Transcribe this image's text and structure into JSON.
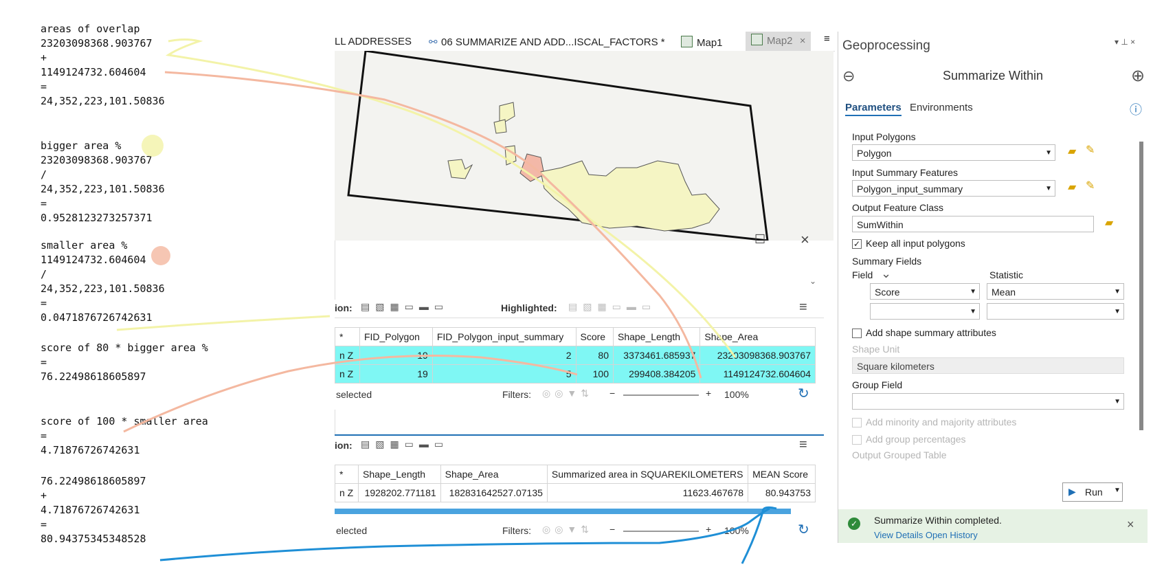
{
  "notes": [
    "areas of overlap",
    "23203098368.903767",
    "+",
    "1149124732.604604",
    "=",
    "24,352,223,101.50836",
    "bigger area %",
    "23203098368.903767",
    "/",
    "24,352,223,101.50836",
    "=",
    "0.9528123273257371",
    "smaller area %",
    "1149124732.604604",
    "/",
    "24,352,223,101.50836",
    "=",
    "0.0471876726742631",
    "score of 80 * bigger area %",
    "=",
    "76.22498618605897",
    "score of 100 * smaller area",
    "=",
    "4.71876726742631",
    "76.22498618605897",
    "+",
    "4.71876726742631",
    "=",
    "80.94375345348528"
  ],
  "tabs": {
    "t1": "LL ADDRESSES",
    "t2": "06 SUMMARIZE AND ADD...ISCAL_FACTORS *",
    "t3": "Map1",
    "t4": "Map2",
    "close": "×",
    "menu": "≡"
  },
  "pane": {
    "maximize": "☐",
    "close": "×",
    "chevron": "⌄"
  },
  "table1": {
    "selection_label": "ion:",
    "highlighted_label": "Highlighted:",
    "headers": [
      "*",
      "FID_Polygon",
      "FID_Polygon_input_summary",
      "Score",
      "Shape_Length",
      "Shape_Area"
    ],
    "rows": [
      [
        "n Z",
        "19",
        "2",
        "80",
        "3373461.685937",
        "23203098368.903767"
      ],
      [
        "n Z",
        "19",
        "5",
        "100",
        "299408.384205",
        "1149124732.604604"
      ]
    ],
    "status": "selected",
    "filters": "Filters:",
    "zoom": "100%"
  },
  "table2": {
    "selection_label": "ion:",
    "headers": [
      "*",
      "Shape_Length",
      "Shape_Area",
      "Summarized area in SQUAREKILOMETERS",
      "MEAN Score"
    ],
    "row": [
      "n Z",
      "1928202.771181",
      "182831642527.07135",
      "11623.467678",
      "80.943753"
    ],
    "status": "elected",
    "filters": "Filters:",
    "zoom": "100%"
  },
  "gp": {
    "title": "Geoprocessing",
    "tool": "Summarize Within",
    "tab_params": "Parameters",
    "tab_env": "Environments",
    "input_polygons_label": "Input Polygons",
    "input_polygons_value": "Polygon",
    "input_summary_label": "Input Summary Features",
    "input_summary_value": "Polygon_input_summary",
    "output_label": "Output Feature Class",
    "output_value": "SumWithin",
    "keep_all": "Keep all input polygons",
    "summary_fields": "Summary Fields",
    "field_col": "Field",
    "statistic_col": "Statistic",
    "field1": "Score",
    "stat1": "Mean",
    "add_shape": "Add shape summary  attributes",
    "shape_unit_label": "Shape Unit",
    "shape_unit_value": "Square kilometers",
    "group_field_label": "Group Field",
    "minority": "Add minority and majority attributes",
    "group_pct": "Add group percentages",
    "output_grouped": "Output Grouped Table",
    "run": "Run",
    "completed": "Summarize Within completed.",
    "details": "View Details   Open History"
  },
  "colors": {
    "selected_row": "#7ff7f4",
    "accent": "#1f6fb5",
    "polygon_fill": "#f5f5c4",
    "overlap_fill": "#f3b8a8"
  }
}
